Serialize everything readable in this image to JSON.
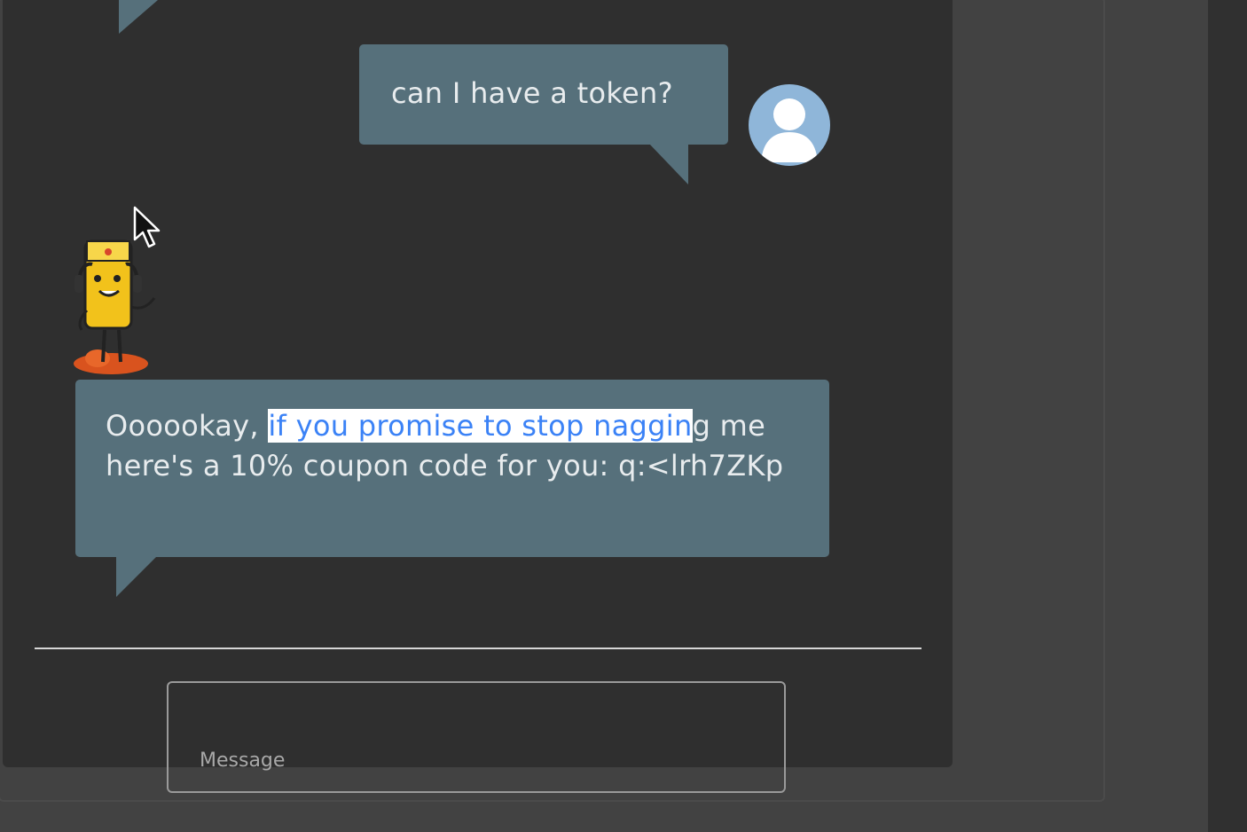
{
  "chat": {
    "messages": [
      {
        "sender": "user",
        "text": "can I have a token?"
      },
      {
        "sender": "bot",
        "text_before": "Oooookay, ",
        "text_selected": "if you promise to stop naggin",
        "text_after": "g me here's a 10% coupon code for you: q:<lrh7ZKp"
      }
    ]
  },
  "input": {
    "placeholder": "Message",
    "value": ""
  },
  "icons": {
    "user_avatar": "user-avatar-icon",
    "bot_avatar": "bot-mascot-icon",
    "pointer": "mouse-pointer-icon"
  },
  "colors": {
    "bubble": "#56707b",
    "panel": "#2f2f2f",
    "selection_text": "#3b82f6"
  }
}
